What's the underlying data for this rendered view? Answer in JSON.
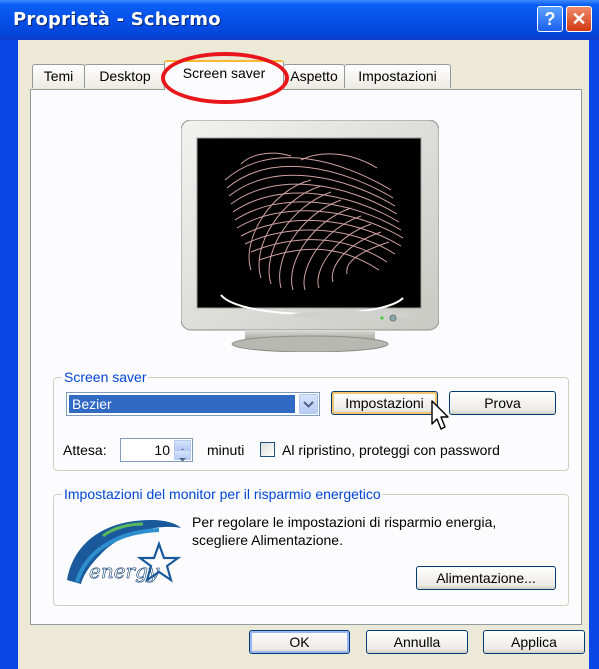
{
  "window": {
    "title": "Proprietà - Schermo",
    "help_symbol": "?",
    "close_symbol": "✕"
  },
  "tabs": [
    {
      "label": "Temi"
    },
    {
      "label": "Desktop"
    },
    {
      "label": "Screen saver"
    },
    {
      "label": "Aspetto"
    },
    {
      "label": "Impostazioni"
    }
  ],
  "active_tab": "Screen saver",
  "screensaver_group": {
    "title": "Screen saver",
    "selected": "Bezier",
    "settings_button": "Impostazioni",
    "preview_button": "Prova",
    "wait_label": "Attesa:",
    "wait_value": "10",
    "minutes_label": "minuti",
    "password_label": "Al ripristino, proteggi con password",
    "password_checked": false
  },
  "power_group": {
    "title": "Impostazioni del monitor per il risparmio energetico",
    "description_line1": "Per regolare le impostazioni di risparmio energia,",
    "description_line2": "scegliere Alimentazione.",
    "power_button": "Alimentazione..."
  },
  "footer": {
    "ok": "OK",
    "cancel": "Annulla",
    "apply": "Applica"
  },
  "colors": {
    "accent": "#0a46e6",
    "group_title": "#0046d5",
    "highlight_circle": "#e8161a",
    "selection": "#316ac5"
  },
  "icons": {
    "monitor_preview": "crt-monitor-icon",
    "energy_star": "energy-star-logo",
    "dropdown": "chevron-down-icon",
    "pointer": "mouse-cursor-icon"
  }
}
